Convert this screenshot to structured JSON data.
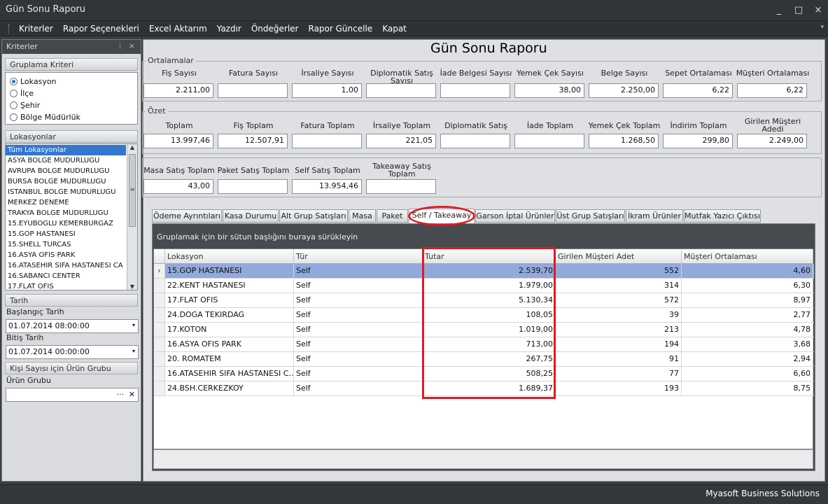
{
  "window": {
    "title": "Gün Sonu Raporu",
    "controls": [
      "_",
      "□",
      "×"
    ]
  },
  "menu": [
    "Kriterler",
    "Rapor Seçenekleri",
    "Excel Aktarım",
    "Yazdır",
    "Öndeğerler",
    "Rapor Güncelle",
    "Kapat"
  ],
  "sidebar": {
    "title": "Kriterler",
    "pin": "ᛁ",
    "close": "×",
    "grouping": {
      "label": "Gruplama Kriteri",
      "options": [
        "Lokasyon",
        "İlçe",
        "Şehir",
        "Bölge Müdürlük"
      ],
      "selected": "Lokasyon"
    },
    "locations": {
      "label": "Lokasyonlar",
      "items": [
        "Tüm Lokasyonlar",
        "ASYA BOLGE MUDURLUGU",
        "AVRUPA BOLGE MUDURLUGU",
        "BURSA BOLGE MUDURLUGU",
        "ISTANBUL BOLGE MUDURLUGU",
        "MERKEZ DENEME",
        "TRAKYA BOLGE MUDURLUGU",
        "15.EYUBOGLU KEMERBURGAZ",
        "15.GOP HASTANESI",
        "15.SHELL TURCAS",
        "16.ASYA OFIS PARK",
        "16.ATASEHIR SIFA HASTANESI CA",
        "16.SABANCI CENTER",
        "17.FLAT OFIS"
      ],
      "selected": "Tüm Lokasyonlar"
    },
    "date": {
      "label": "Tarih",
      "start_label": "Başlangıç Tarih",
      "start_value": "01.07.2014 08:00:00",
      "end_label": "Bitiş Tarih",
      "end_value": "01.07.2014 00:00:00"
    },
    "product": {
      "label": "Kişi Sayısı için Ürün Grubu",
      "field_label": "Ürün Grubu",
      "value": "",
      "ellipsis": "···",
      "clear": "✕"
    }
  },
  "report": {
    "title": "Gün Sonu Raporu",
    "averages": {
      "legend": "Ortalamalar",
      "labels": [
        "Fiş Sayısı",
        "Fatura Sayısı",
        "İrsaliye Sayısı",
        "Diplomatik Satış Sayısı",
        "İade Belgesi Sayısı",
        "Yemek Çek Sayısı",
        "Belge Sayısı",
        "Sepet Ortalaması",
        "Müşteri Ortalaması"
      ],
      "values": [
        "2.211,00",
        "",
        "1,00",
        "",
        "",
        "38,00",
        "2.250,00",
        "6,22",
        "6,22"
      ]
    },
    "summary": {
      "legend": "Özet",
      "labels": [
        "Toplam",
        "Fiş Toplam",
        "Fatura Toplam",
        "İrsaliye Toplam",
        "Diplomatik Satış",
        "İade Toplam",
        "Yemek Çek Toplam",
        "İndirim Toplam",
        "Girilen Müşteri Adedi"
      ],
      "values": [
        "13.997,46",
        "12.507,91",
        "",
        "221,05",
        "",
        "",
        "1.268,50",
        "299,80",
        "2.249,00"
      ]
    },
    "sales": {
      "labels": [
        "Masa Satış Toplam",
        "Paket Satış Toplam",
        "Self Satış Toplam",
        "Takeaway Satış Toplam"
      ],
      "values": [
        "43,00",
        "",
        "13.954,46",
        ""
      ]
    }
  },
  "tabs": [
    "Ödeme Ayrıntıları",
    "Kasa Durumu",
    "Alt Grup Satışları",
    "Masa",
    "Paket",
    "Self / Takeaway",
    "Garson İptal Ürünler",
    "Üst Grup Satışları",
    "İkram Ürünler",
    "Mutfak Yazıcı Çıktısı"
  ],
  "active_tab": "Self / Takeaway",
  "grid": {
    "group_hint": "Gruplamak için bir sütun başlığını buraya sürükleyin",
    "row_indicator": "›",
    "columns": [
      "Lokasyon",
      "Tür",
      "Tutar",
      "Girilen Müşteri Adet",
      "Müşteri Ortalaması"
    ],
    "rows": [
      [
        "15.GOP HASTANESI",
        "Self",
        "2.539,70",
        "552",
        "4,60"
      ],
      [
        "22.KENT HASTANESI",
        "Self",
        "1.979,00",
        "314",
        "6,30"
      ],
      [
        "17.FLAT OFIS",
        "Self",
        "5.130,34",
        "572",
        "8,97"
      ],
      [
        "24.DOGA TEKIRDAG",
        "Self",
        "108,05",
        "39",
        "2,77"
      ],
      [
        "17.KOTON",
        "Self",
        "1.019,00",
        "213",
        "4,78"
      ],
      [
        "16.ASYA OFIS PARK",
        "Self",
        "713,00",
        "194",
        "3,68"
      ],
      [
        "20. ROMATEM",
        "Self",
        "267,75",
        "91",
        "2,94"
      ],
      [
        "16.ATASEHIR SIFA HASTANESI C...",
        "Self",
        "508,25",
        "77",
        "6,60"
      ],
      [
        "24.BSH.CERKEZKOY",
        "Self",
        "1.689,37",
        "193",
        "8,75"
      ]
    ],
    "selected_row": 0
  },
  "status": {
    "text": "Myasoft Business Solutions"
  },
  "colors": {
    "highlight": "#e01a22",
    "selection": "#3476d0",
    "row_selection": "#92a9dc"
  }
}
